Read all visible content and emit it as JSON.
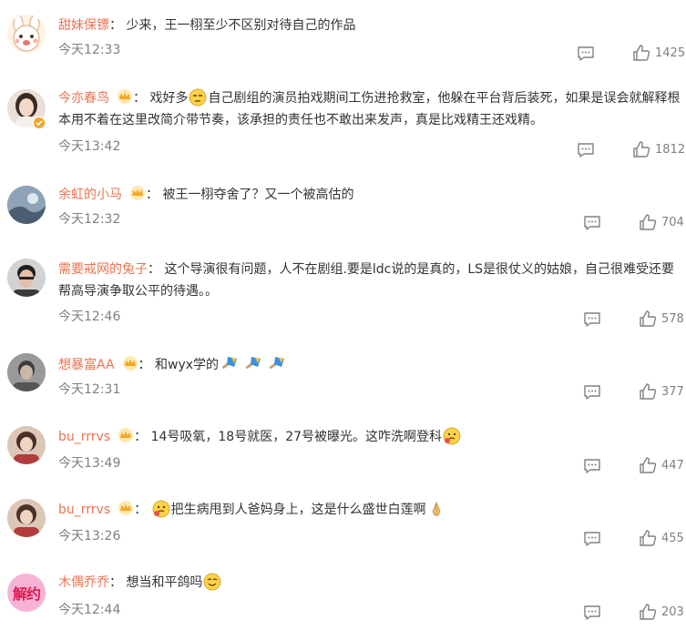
{
  "comments": [
    {
      "user": "甜妹保镖",
      "badge": false,
      "segments": [
        "少来，王一栩至少不区别对待自己的作品"
      ],
      "time": "今天12:33",
      "likes": "1425"
    },
    {
      "user": "今亦春鸟",
      "badge": true,
      "segments": [
        "戏好多",
        "自己剧组的演员拍戏期间工伤进抢救室，他躲在平台背后装死，如果是误会就解释根本用不着在这里改简介带节奏，该承担的责任也不敢出来发声，真是比戏精王还戏精。"
      ],
      "time": "今天13:42",
      "likes": "1812"
    },
    {
      "user": "余虹的小马",
      "badge": true,
      "segments": [
        "被王一栩夺舍了？又一个被高估的"
      ],
      "time": "今天12:32",
      "likes": "704"
    },
    {
      "user": "需要戒网的兔子",
      "badge": false,
      "segments": [
        "这个导演很有问题，人不在剧组.要是ldc说的是真的，LS是很仗义的姑娘，自己很难受还要帮高导演争取公平的待遇。。"
      ],
      "time": "今天12:46",
      "likes": "578"
    },
    {
      "user": "想暴富AA",
      "badge": true,
      "segments": [
        "和wyx学的"
      ],
      "time": "今天12:31",
      "likes": "377"
    },
    {
      "user": "bu_rrrvs",
      "badge": true,
      "segments": [
        "14号吸氧，18号就医，27号被曝光。这咋洗啊登科"
      ],
      "time": "今天13:49",
      "likes": "447"
    },
    {
      "user": "bu_rrrvs",
      "badge": true,
      "segments": [
        "",
        "把生病甩到人爸妈身上，这是什么盛世白莲啊"
      ],
      "time": "今天13:26",
      "likes": "455"
    },
    {
      "user": "木偶乔乔",
      "badge": false,
      "segments": [
        "想当和平鸽吗"
      ],
      "time": "今天12:44",
      "likes": "203"
    }
  ],
  "avatar_label_8": "解约",
  "colors": {
    "username": "#eb7350",
    "text": "#333333",
    "meta": "#808080",
    "badge": "#f5a623"
  }
}
